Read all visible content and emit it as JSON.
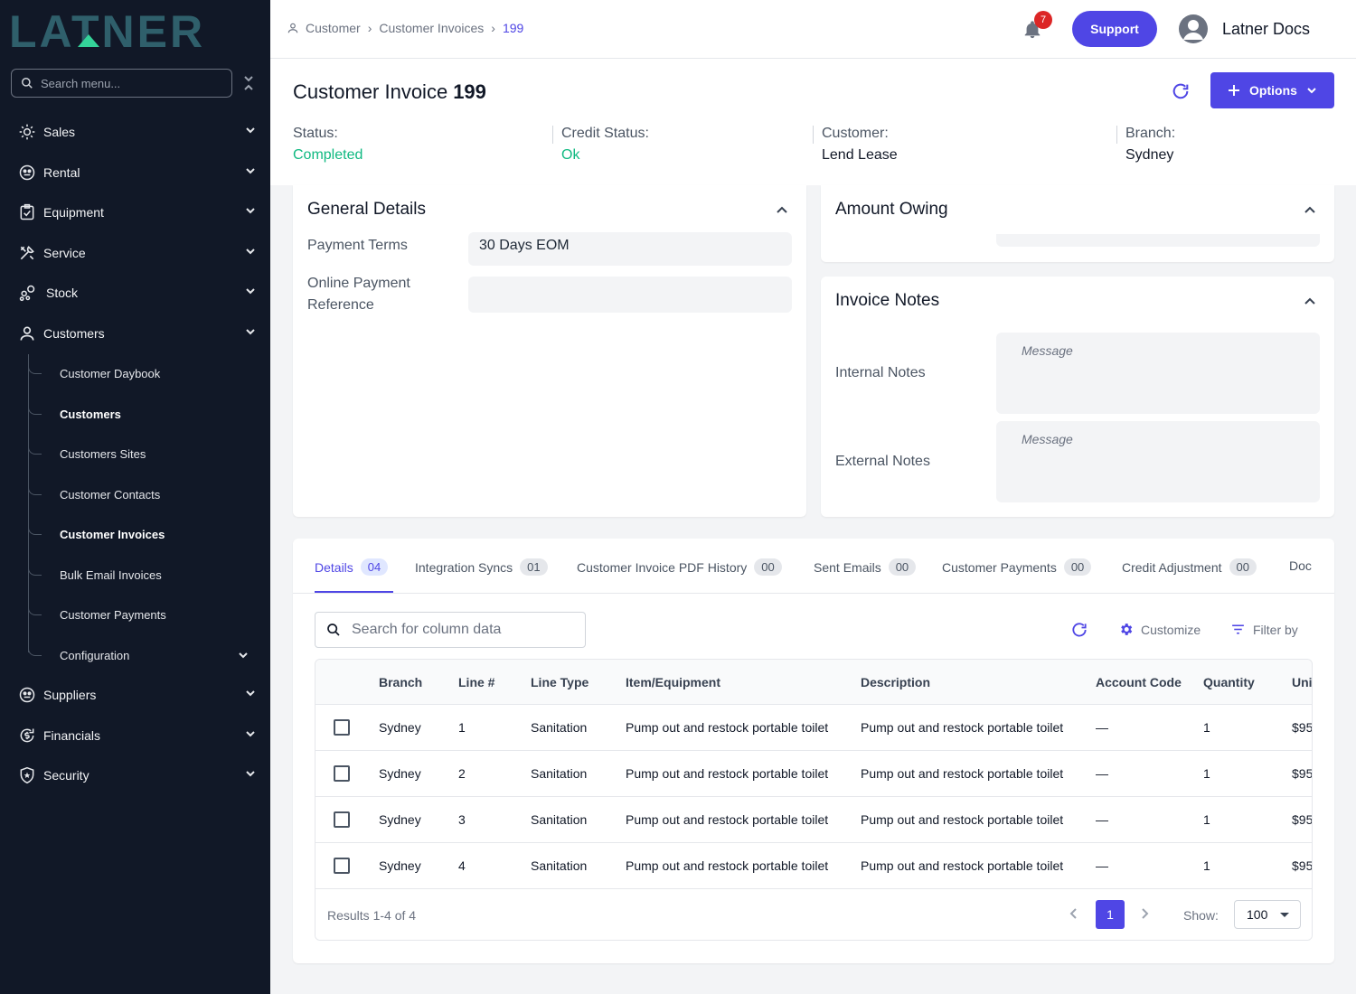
{
  "sidebar": {
    "logo_text": "LATNER",
    "search_placeholder": "Search menu...",
    "items": [
      {
        "label": "Sales",
        "icon": "sales-icon"
      },
      {
        "label": "Rental",
        "icon": "rental-icon"
      },
      {
        "label": "Equipment",
        "icon": "equipment-icon"
      },
      {
        "label": "Service",
        "icon": "tools-icon"
      },
      {
        "label": "Stock",
        "icon": "stock-icon"
      },
      {
        "label": "Customers",
        "icon": "user-icon"
      },
      {
        "label": "Suppliers",
        "icon": "suppliers-icon"
      },
      {
        "label": "Financials",
        "icon": "financials-icon"
      },
      {
        "label": "Security",
        "icon": "shield-icon"
      }
    ],
    "customer_subitems": [
      {
        "label": "Customer Daybook"
      },
      {
        "label": "Customers"
      },
      {
        "label": "Customers Sites"
      },
      {
        "label": "Customer Contacts"
      },
      {
        "label": "Customer Invoices"
      },
      {
        "label": "Bulk Email Invoices"
      },
      {
        "label": "Customer Payments"
      },
      {
        "label": "Configuration"
      }
    ]
  },
  "header": {
    "breadcrumb": [
      "Customer",
      "Customer Invoices",
      "199"
    ],
    "notification_count": "7",
    "support_label": "Support",
    "user_name": "Latner Docs"
  },
  "invoice": {
    "title": "Customer Invoice",
    "number": "199",
    "options_label": "Options",
    "status_label": "Status:",
    "status_value": "Completed",
    "credit_label": "Credit Status:",
    "credit_value": "Ok",
    "customer_label": "Customer:",
    "customer_value": "Lend Lease",
    "branch_label": "Branch:",
    "branch_value": "Sydney"
  },
  "general": {
    "title": "General Details",
    "payment_terms_label": "Payment Terms",
    "payment_terms_value": "30 Days EOM",
    "online_ref_label": "Online Payment Reference",
    "online_ref_value": ""
  },
  "amount_owing": {
    "title": "Amount Owing"
  },
  "notes": {
    "title": "Invoice Notes",
    "internal_label": "Internal Notes",
    "internal_placeholder": "Message",
    "external_label": "External Notes",
    "external_placeholder": "Message"
  },
  "tabs": [
    {
      "label": "Details",
      "count": "04"
    },
    {
      "label": "Integration Syncs",
      "count": "01"
    },
    {
      "label": "Customer Invoice PDF History",
      "count": "00"
    },
    {
      "label": "Sent Emails",
      "count": "00"
    },
    {
      "label": "Customer Payments",
      "count": "00"
    },
    {
      "label": "Credit Adjustment",
      "count": "00"
    },
    {
      "label": "Doc",
      "count": ""
    }
  ],
  "table": {
    "search_placeholder": "Search for column data",
    "customize_label": "Customize",
    "filter_label": "Filter by",
    "columns": [
      "Branch",
      "Line #",
      "Line Type",
      "Item/Equipment",
      "Description",
      "Account Code",
      "Quantity",
      "Uni"
    ],
    "rows": [
      [
        "Sydney",
        "1",
        "Sanitation",
        "Pump out and restock portable toilet",
        "Pump out and restock portable toilet",
        "—",
        "1",
        "$95"
      ],
      [
        "Sydney",
        "2",
        "Sanitation",
        "Pump out and restock portable toilet",
        "Pump out and restock portable toilet",
        "—",
        "1",
        "$95"
      ],
      [
        "Sydney",
        "3",
        "Sanitation",
        "Pump out and restock portable toilet",
        "Pump out and restock portable toilet",
        "—",
        "1",
        "$95"
      ],
      [
        "Sydney",
        "4",
        "Sanitation",
        "Pump out and restock portable toilet",
        "Pump out and restock portable toilet",
        "—",
        "1",
        "$95"
      ]
    ],
    "results_text": "Results 1-4 of 4",
    "current_page": "1",
    "show_label": "Show:",
    "page_size": "100"
  },
  "colors": {
    "accent": "#4f46e5",
    "sidebar_bg": "#111827",
    "status_green": "#10b981",
    "logo_teal": "#2f5f6b",
    "logo_accent": "#34d399",
    "badge_red": "#dc2626"
  }
}
